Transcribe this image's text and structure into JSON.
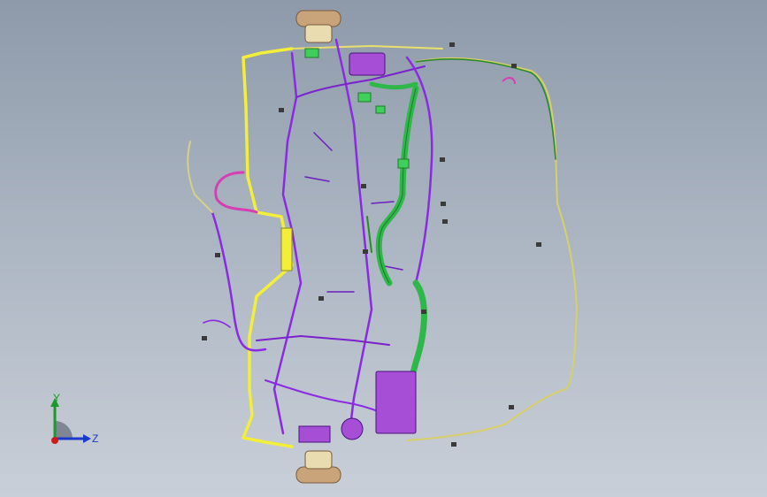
{
  "viewport": {
    "background_top": "#8e9aaa",
    "background_bottom": "#c9cfd8"
  },
  "model": {
    "colors": {
      "purple": "#8a2be2",
      "dark_purple": "#5b1a9a",
      "yellow": "#f2ee3a",
      "green": "#2fb84a",
      "dark_green": "#1f7a2a",
      "magenta": "#d63fb4",
      "tan": "#c9a47a",
      "beige": "#e8dcb0"
    }
  },
  "triad": {
    "y_label": "Y",
    "z_label": "Z",
    "y_color": "#1a9a2a",
    "z_color": "#1a3acc",
    "x_color": "#cc1a1a"
  }
}
